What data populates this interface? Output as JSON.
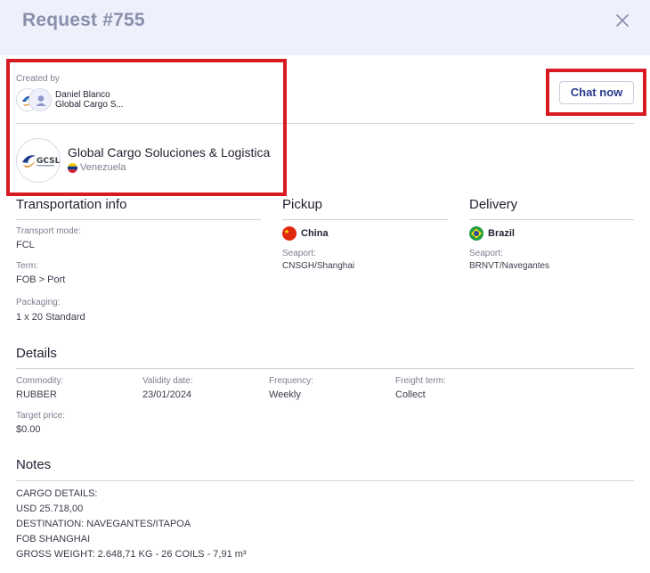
{
  "header": {
    "title": "Request #755"
  },
  "creator": {
    "label": "Created by",
    "name": "Daniel Blanco",
    "company": "Global Cargo S..."
  },
  "actions": {
    "chat_label": "Chat now"
  },
  "company": {
    "name": "Global Cargo Soluciones & Logistica",
    "country": "Venezuela",
    "logo_text": "GCSL"
  },
  "transportation": {
    "title": "Transportation info",
    "mode_label": "Transport mode:",
    "mode_value": "FCL",
    "term_label": "Term:",
    "term_value": "FOB > Port",
    "packaging_label": "Packaging:",
    "packaging_value": "1 x 20 Standard"
  },
  "pickup": {
    "title": "Pickup",
    "country": "China",
    "seaport_label": "Seaport:",
    "seaport_value": "CNSGH/Shanghai"
  },
  "delivery": {
    "title": "Delivery",
    "country": "Brazil",
    "seaport_label": "Seaport:",
    "seaport_value": "BRNVT/Navegantes"
  },
  "details": {
    "title": "Details",
    "commodity_label": "Commodity:",
    "commodity_value": "RUBBER",
    "validity_label": "Validity date:",
    "validity_value": "23/01/2024",
    "frequency_label": "Frequency:",
    "frequency_value": "Weekly",
    "freight_label": "Freight term:",
    "freight_value": "Collect",
    "target_label": "Target price:",
    "target_value": "$0.00"
  },
  "notes": {
    "title": "Notes",
    "lines": [
      "CARGO DETAILS:",
      "USD 25.718,00",
      "DESTINATION: NAVEGANTES/ITAPOA",
      "FOB SHANGHAI",
      "GROSS WEIGHT: 2.648,71 KG - 26 COILS - 7,91 m³"
    ]
  },
  "colors": {
    "header_bg": "#eef0fb",
    "accent": "#2b3a8c",
    "highlight": "#d81b23"
  }
}
